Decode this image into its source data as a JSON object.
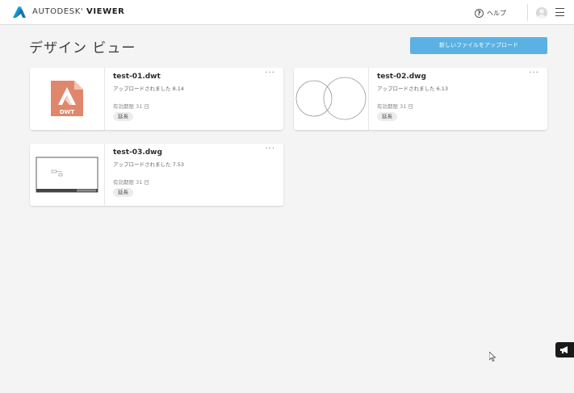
{
  "header": {
    "brand_name": "AUTODESK",
    "brand_product": "VIEWER",
    "help_label": "ヘルプ"
  },
  "main": {
    "title": "デザイン ビュー",
    "upload_button": "新しいファイルをアップロード",
    "files": [
      {
        "name": "test-01.dwt",
        "uploaded": "アップロードされました 8.14",
        "expiry": "有効期限 31 日",
        "extend_label": "延長",
        "thumb_label": "DWT"
      },
      {
        "name": "test-02.dwg",
        "uploaded": "アップロードされました 6.13",
        "expiry": "有効期限 31 日",
        "extend_label": "延長"
      },
      {
        "name": "test-03.dwg",
        "uploaded": "アップロードされました 7.53",
        "expiry": "有効期限 31 日",
        "extend_label": "延長"
      }
    ],
    "more_label": "···"
  },
  "colors": {
    "accent": "#5ab1e3",
    "dwt_icon": "#e0876b",
    "background": "#f4f4f5"
  },
  "icons": [
    "autodesk-logo-icon",
    "help-icon",
    "avatar-icon",
    "hamburger-menu-icon",
    "more-options-icon",
    "megaphone-icon",
    "mouse-cursor-icon"
  ]
}
